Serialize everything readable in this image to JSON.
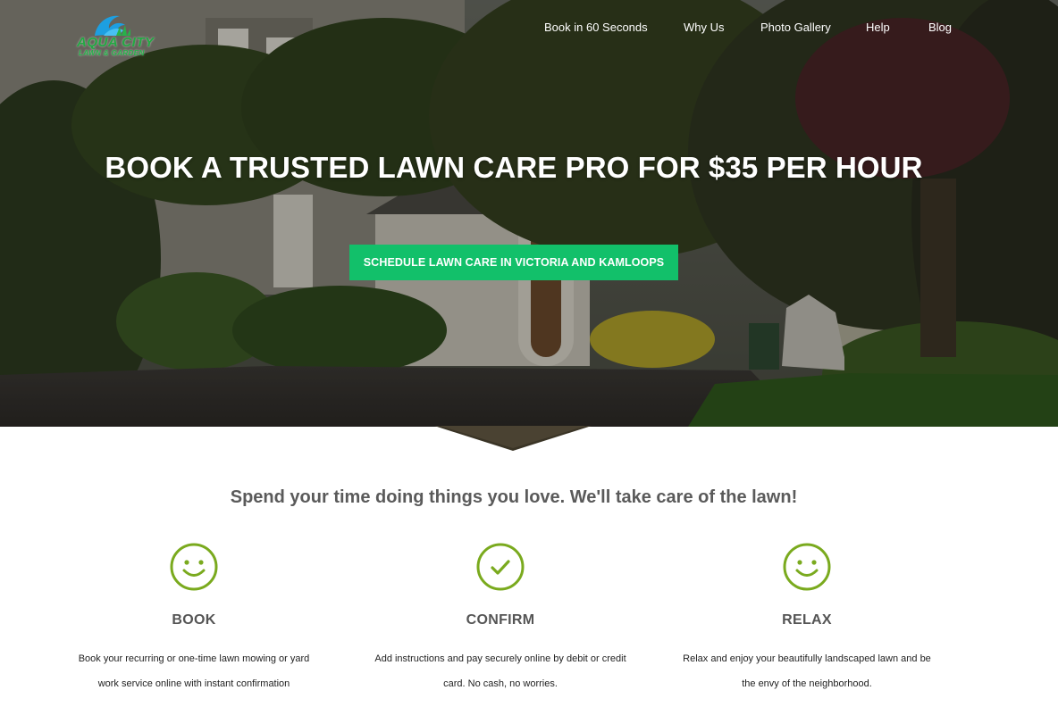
{
  "logo": {
    "name": "AQUA CITY",
    "sub": "LAWN & GARDEN"
  },
  "nav": {
    "items": [
      {
        "label": "Book in 60 Seconds"
      },
      {
        "label": "Why Us"
      },
      {
        "label": "Photo Gallery"
      },
      {
        "label": "Help"
      },
      {
        "label": "Blog"
      }
    ]
  },
  "hero": {
    "headline": "BOOK A TRUSTED LAWN CARE PRO FOR $35 PER HOUR",
    "cta_label": "SCHEDULE LAWN CARE IN VICTORIA AND KAMLOOPS"
  },
  "tagline": "Spend your time doing things you love. We'll take care of the lawn!",
  "steps": [
    {
      "icon": "smiley-icon",
      "title": "BOOK",
      "text": "Book your recurring or one-time lawn mowing or yard work service online with instant confirmation"
    },
    {
      "icon": "checkmark-icon",
      "title": "CONFIRM",
      "text": "Add instructions and pay securely online by debit or credit card. No cash, no worries."
    },
    {
      "icon": "smiley-icon",
      "title": "RELAX",
      "text": "Relax and enjoy your beautifully landscaped lawn and be the envy of the neighborhood."
    }
  ],
  "colors": {
    "accent_green": "#12c06a",
    "icon_green": "#7aaa1e",
    "heading_gray": "#555555"
  }
}
